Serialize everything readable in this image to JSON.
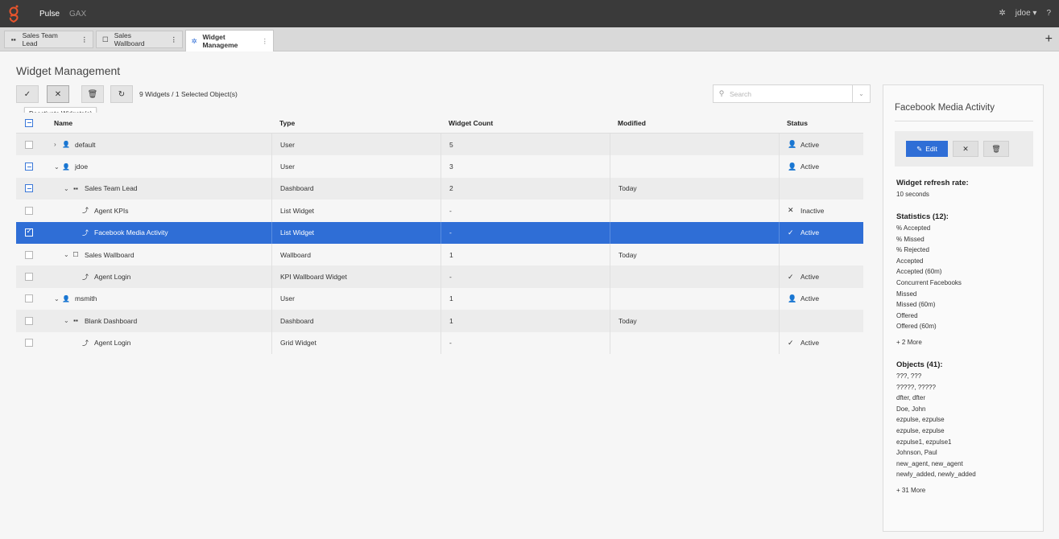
{
  "topbar": {
    "app_name": "Pulse",
    "app_name2": "GAX",
    "user": "jdoe ▾",
    "help": "?"
  },
  "tabs": [
    {
      "label": "Sales Team Lead",
      "icon": "dashboard-grid-icon"
    },
    {
      "label": "Sales Wallboard",
      "icon": "wallboard-square-icon"
    },
    {
      "label": "Widget Manageme",
      "icon": "gear-icon"
    }
  ],
  "page": {
    "title": "Widget Management"
  },
  "toolbar": {
    "widget_count": "9 Widgets / 1 Selected Object(s)",
    "tooltip": "Deactivate Widgets(s)",
    "search_placeholder": "Search"
  },
  "table": {
    "columns": {
      "name": "Name",
      "type": "Type",
      "count": "Widget Count",
      "modified": "Modified",
      "status": "Status"
    },
    "rows": [
      {
        "name": "default",
        "type": "User",
        "count": "5",
        "modified": "",
        "status": "Active",
        "status_icon": "user-icon",
        "icon": "user-icon",
        "expander": "›",
        "indent": 0
      },
      {
        "name": "jdoe",
        "type": "User",
        "count": "3",
        "modified": "",
        "status": "Active",
        "status_icon": "user-icon",
        "icon": "user-icon",
        "expander": "⌄",
        "indent": 0
      },
      {
        "name": "Sales Team Lead",
        "type": "Dashboard",
        "count": "2",
        "modified": "Today",
        "status": "",
        "icon": "dashboard-grid-icon",
        "expander": "⌄",
        "indent": 1
      },
      {
        "name": "Agent KPIs",
        "type": "List Widget",
        "count": "-",
        "modified": "",
        "status": "Inactive",
        "status_icon": "x-icon",
        "icon": "widget-chart-icon",
        "indent": 2
      },
      {
        "name": "Facebook Media Activity",
        "type": "List Widget",
        "count": "-",
        "modified": "",
        "status": "Active",
        "status_icon": "check-icon",
        "icon": "widget-chart-icon",
        "indent": 2
      },
      {
        "name": "Sales Wallboard",
        "type": "Wallboard",
        "count": "1",
        "modified": "Today",
        "status": "",
        "icon": "wallboard-square-icon",
        "expander": "⌄",
        "indent": 1
      },
      {
        "name": "Agent Login",
        "type": "KPI Wallboard Widget",
        "count": "-",
        "modified": "",
        "status": "Active",
        "status_icon": "check-icon",
        "icon": "widget-chart-icon",
        "indent": 2
      },
      {
        "name": "msmith",
        "type": "User",
        "count": "1",
        "modified": "",
        "status": "Active",
        "status_icon": "user-icon",
        "icon": "user-icon",
        "expander": "⌄",
        "indent": 0
      },
      {
        "name": "Blank Dashboard",
        "type": "Dashboard",
        "count": "1",
        "modified": "Today",
        "status": "",
        "icon": "dashboard-grid-icon",
        "expander": "⌄",
        "indent": 1
      },
      {
        "name": "Agent Login",
        "type": "Grid Widget",
        "count": "-",
        "modified": "",
        "status": "Active",
        "status_icon": "check-icon",
        "icon": "widget-chart-icon",
        "indent": 2
      }
    ]
  },
  "panel": {
    "title": "Facebook Media Activity",
    "edit_label": "Edit",
    "refresh_heading": "Widget refresh rate:",
    "refresh_value": "10 seconds",
    "stats_heading": "Statistics (12):",
    "stats": [
      "% Accepted",
      "% Missed",
      "% Rejected",
      "Accepted",
      "Accepted (60m)",
      "Concurrent Facebooks",
      "Missed",
      "Missed (60m)",
      "Offered",
      "Offered (60m)"
    ],
    "stats_more": "+ 2 More",
    "objects_heading": "Objects (41):",
    "objects": [
      "???, ???",
      "?????, ?????",
      "dfter, dfter",
      "Doe, John",
      "ezpulse, ezpulse",
      "ezpulse, ezpulse",
      "ezpulse1, ezpulse1",
      "Johnson, Paul",
      "new_agent, new_agent",
      "newly_added, newly_added"
    ],
    "objects_more": "+ 31 More"
  },
  "colors": {
    "topbar": "#3a3a3a",
    "brand_logo": "#e8542c",
    "accent_blue": "#2f6ed6"
  }
}
